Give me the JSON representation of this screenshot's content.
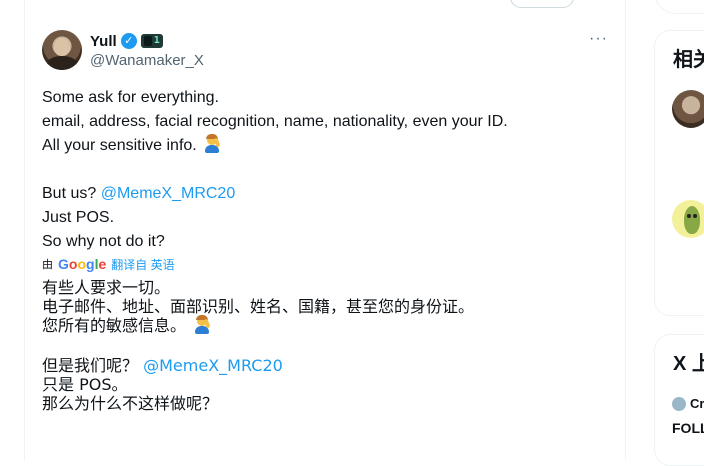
{
  "tweet": {
    "display_name": "Yull",
    "verified_mark": "✓",
    "badge_text": "1",
    "handle": "@Wanamaker_X",
    "more_label": "···",
    "lines": [
      "Some ask for everything.",
      "email, address, facial recognition, name, nationality, even your ID.",
      "All your sensitive info."
    ],
    "but_us": "But us?",
    "mention": "@MemeX_MRC20",
    "just_pos": "Just POS.",
    "why_not": "So why not do it?"
  },
  "translation": {
    "by_label": "由",
    "google": [
      "G",
      "o",
      "o",
      "g",
      "l",
      "e"
    ],
    "link": "翻译自 英语",
    "lines": [
      "有些人要求一切。",
      "电子邮件、地址、面部识别、姓名、国籍，甚至您的身份证。",
      "您所有的敏感信息。"
    ],
    "but_us": "但是我们呢？",
    "mention": "@MemeX_MRC20",
    "just_pos": "只是 POS。",
    "why_not": "那么为什么不这样做呢？"
  },
  "sidebar": {
    "related_title": "相关",
    "trends_title": "X 上",
    "small_row_text": "Cr",
    "foll_text": "FOLL"
  },
  "icons": {
    "verified": "verified-icon",
    "emoji": "person-gesturing-emoji",
    "more": "more-icon"
  },
  "colors": {
    "accent": "#1d9bf0",
    "text": "#0f1419",
    "secondary": "#536471"
  }
}
